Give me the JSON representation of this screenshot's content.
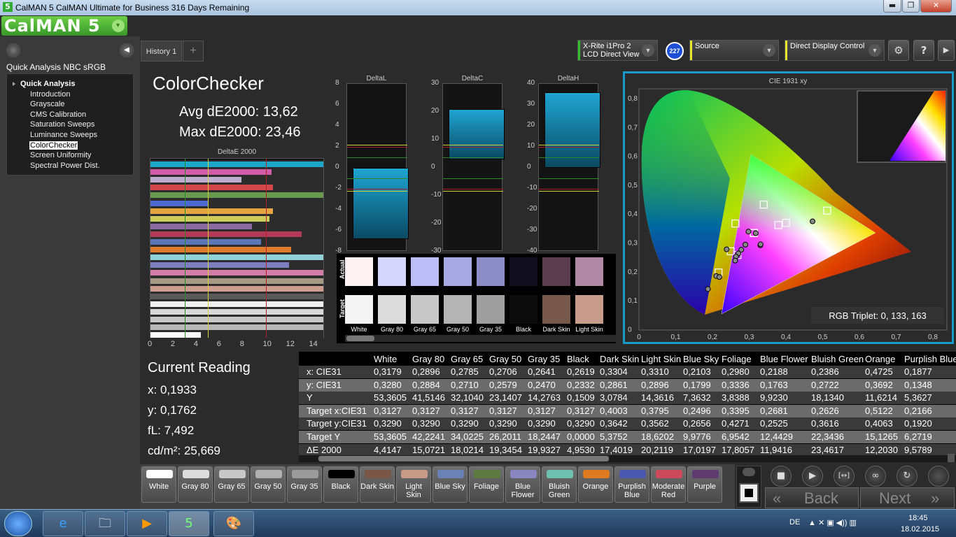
{
  "window": {
    "title": "CalMAN 5 CalMAN Ultimate for Business 316 Days Remaining",
    "app_icon": "5",
    "minimize": "▬",
    "maximize": "❐",
    "close": "✕"
  },
  "logo": {
    "text": "CalMAN 5",
    "dropdown": "▾"
  },
  "left_panel": {
    "section_title": "Quick Analysis NBC sRGB",
    "collapse": "◀",
    "group": "Quick Analysis",
    "items": [
      "Introduction",
      "Grayscale",
      "CMS Calibration",
      "Saturation Sweeps",
      "Luminance Sweeps",
      "ColorChecker",
      "Screen Uniformity",
      "Spectral Power Dist."
    ],
    "selected": "ColorChecker"
  },
  "tabs": {
    "active": "History 1",
    "add": "+"
  },
  "devices": {
    "meter": {
      "line1": "X-Rite i1Pro 2",
      "line2": "LCD Direct View",
      "badge": "227",
      "color": "#2fbf2f"
    },
    "source": {
      "label": "Source",
      "color": "#e6e62a"
    },
    "display": {
      "label": "Direct Display Control",
      "color": "#e6e62a"
    },
    "settings_icon": "⚙",
    "help": "?",
    "collapse": "▶"
  },
  "colorchecker": {
    "title": "ColorChecker",
    "avg": "Avg dE2000: 13,62",
    "max": "Max dE2000: 23,46"
  },
  "deltaE_chart": {
    "title": "DeltaE 2000",
    "xticks": [
      "0",
      "2",
      "4",
      "6",
      "8",
      "10",
      "12",
      "14"
    ],
    "xmax": 15,
    "values": [
      15,
      10.5,
      7.9,
      10.6,
      15,
      5,
      10.6,
      10.3,
      8.8,
      13.1,
      9.6,
      12.2,
      15,
      12,
      15,
      15,
      15,
      15,
      15,
      15,
      15,
      15,
      4.4
    ],
    "colors": [
      "#1aa7c9",
      "#d05ca8",
      "#bdaed0",
      "#d2464c",
      "#6a9a50",
      "#4a6ad2",
      "#e4a440",
      "#cfcc5a",
      "#8a6aa0",
      "#b23a58",
      "#5a76b4",
      "#e07a2a",
      "#8fd1d6",
      "#7b7fc0",
      "#d07ea7",
      "#a79a84",
      "#cd9d90",
      "#5a5a5a",
      "#f0f0f0",
      "#d8d8d8",
      "#c8c8c8",
      "#b8b8b8",
      "#fafafa"
    ]
  },
  "delta_charts": [
    {
      "title": "DeltaL",
      "ticks": [
        "8",
        "6",
        "4",
        "2",
        "0",
        "-2",
        "-4",
        "-6",
        "-8"
      ],
      "min": -8,
      "max": 8,
      "bar_from": 0,
      "bar_to": -6.8
    },
    {
      "title": "DeltaC",
      "ticks": [
        "30",
        "20",
        "10",
        "0",
        "-10",
        "-20",
        "-30"
      ],
      "min": -30,
      "max": 30,
      "bar_from": 21,
      "bar_to": 3
    },
    {
      "title": "DeltaH",
      "ticks": [
        "40",
        "30",
        "20",
        "10",
        "0",
        "-10",
        "-20",
        "-30",
        "-40"
      ],
      "min": -40,
      "max": 40,
      "bar_from": 36,
      "bar_to": 0
    }
  ],
  "swatches": {
    "actual_label": "Actual",
    "target_label": "Target",
    "names": [
      "White",
      "Gray 80",
      "Gray 65",
      "Gray 50",
      "Gray 35",
      "Black",
      "Dark Skin",
      "Light Skin"
    ],
    "actual_colors": [
      "#fdf3f3",
      "#d6d6fc",
      "#bcbcf6",
      "#a8a8e2",
      "#8c8cc8",
      "#12101e",
      "#5a3c4e",
      "#b08aa4"
    ],
    "target_colors": [
      "#f4f4f4",
      "#dcdcdc",
      "#c8c8c8",
      "#b4b4b4",
      "#9e9e9e",
      "#0c0c0c",
      "#78584a",
      "#c89c8a"
    ]
  },
  "cie": {
    "title": "CIE 1931 xy",
    "triplet": "RGB Triplet: 0, 133, 163",
    "xticks": [
      "0",
      "0,1",
      "0,2",
      "0,3",
      "0,4",
      "0,5",
      "0,6",
      "0,7",
      "0,8"
    ],
    "yticks": [
      "0,8",
      "0,7",
      "0,6",
      "0,5",
      "0,4",
      "0,3",
      "0,2",
      "0,1",
      "0"
    ]
  },
  "current_reading": {
    "title": "Current Reading",
    "x": "x: 0,1933",
    "y": "y: 0,1762",
    "fl": "fL: 7,492",
    "cd": "cd/m²: 25,669"
  },
  "table": {
    "columns": [
      "",
      "White",
      "Gray 80",
      "Gray 65",
      "Gray 50",
      "Gray 35",
      "Black",
      "Dark Skin",
      "Light Skin",
      "Blue Sky",
      "Foliage",
      "Blue Flower",
      "Bluish Green",
      "Orange",
      "Purplish Blue"
    ],
    "rows": [
      [
        "x: CIE31",
        "0,3179",
        "0,2896",
        "0,2785",
        "0,2706",
        "0,2641",
        "0,2619",
        "0,3304",
        "0,3310",
        "0,2103",
        "0,2980",
        "0,2188",
        "0,2386",
        "0,4725",
        "0,1877"
      ],
      [
        "y: CIE31",
        "0,3280",
        "0,2884",
        "0,2710",
        "0,2579",
        "0,2470",
        "0,2332",
        "0,2861",
        "0,2896",
        "0,1799",
        "0,3336",
        "0,1763",
        "0,2722",
        "0,3692",
        "0,1348"
      ],
      [
        "Y",
        "53,3605",
        "41,5146",
        "32,1040",
        "23,1407",
        "14,2763",
        "0,1509",
        "3,0784",
        "14,3616",
        "7,3632",
        "3,8388",
        "9,9230",
        "18,1340",
        "11,6214",
        "5,3627"
      ],
      [
        "Target x:CIE31",
        "0,3127",
        "0,3127",
        "0,3127",
        "0,3127",
        "0,3127",
        "0,3127",
        "0,4003",
        "0,3795",
        "0,2496",
        "0,3395",
        "0,2681",
        "0,2626",
        "0,5122",
        "0,2166"
      ],
      [
        "Target y:CIE31",
        "0,3290",
        "0,3290",
        "0,3290",
        "0,3290",
        "0,3290",
        "0,3290",
        "0,3642",
        "0,3562",
        "0,2656",
        "0,4271",
        "0,2525",
        "0,3616",
        "0,4063",
        "0,1920"
      ],
      [
        "Target Y",
        "53,3605",
        "42,2241",
        "34,0225",
        "26,2011",
        "18,2447",
        "0,0000",
        "5,3752",
        "18,6202",
        "9,9776",
        "6,9542",
        "12,4429",
        "22,3436",
        "15,1265",
        "6,2719"
      ],
      [
        "ΔE 2000",
        "4,4147",
        "15,0721",
        "18,0214",
        "19,3454",
        "19,9327",
        "4,9530",
        "17,4019",
        "20,2119",
        "17,0197",
        "17,8057",
        "11,9416",
        "23,4617",
        "12,2030",
        "9,5789"
      ]
    ]
  },
  "bottom_buttons": [
    {
      "label": "White",
      "color": "#ffffff"
    },
    {
      "label": "Gray 80",
      "color": "#dcdcdc"
    },
    {
      "label": "Gray 65",
      "color": "#c8c8c8"
    },
    {
      "label": "Gray 50",
      "color": "#b0b0b0"
    },
    {
      "label": "Gray 35",
      "color": "#9a9a9a"
    },
    {
      "label": "Black",
      "color": "#000000"
    },
    {
      "label": "Dark Skin",
      "color": "#7a5646"
    },
    {
      "label": "Light Skin",
      "color": "#c89a88"
    },
    {
      "label": "Blue Sky",
      "color": "#6a82b6"
    },
    {
      "label": "Foliage",
      "color": "#5e7a40"
    },
    {
      "label": "Blue Flower",
      "color": "#8a86c0"
    },
    {
      "label": "Bluish Green",
      "color": "#6ec0b0"
    },
    {
      "label": "Orange",
      "color": "#e07a20"
    },
    {
      "label": "Purplish Blue",
      "color": "#4a58b0"
    },
    {
      "label": "Moderate Red",
      "color": "#cc4a5c"
    },
    {
      "label": "Purple",
      "color": "#5e3a6e"
    }
  ],
  "transport": {
    "stop": "■",
    "play": "▶",
    "fit": "[↔]",
    "loop": "∞",
    "refresh": "↻",
    "back": "Back",
    "next": "Next",
    "back_arrows": "«",
    "next_arrows": "»"
  },
  "taskbar": {
    "lang": "DE",
    "time": "18:45",
    "date": "18.02.2015",
    "apps": [
      "e",
      "🗀",
      "▶",
      "5",
      "🎨"
    ]
  }
}
